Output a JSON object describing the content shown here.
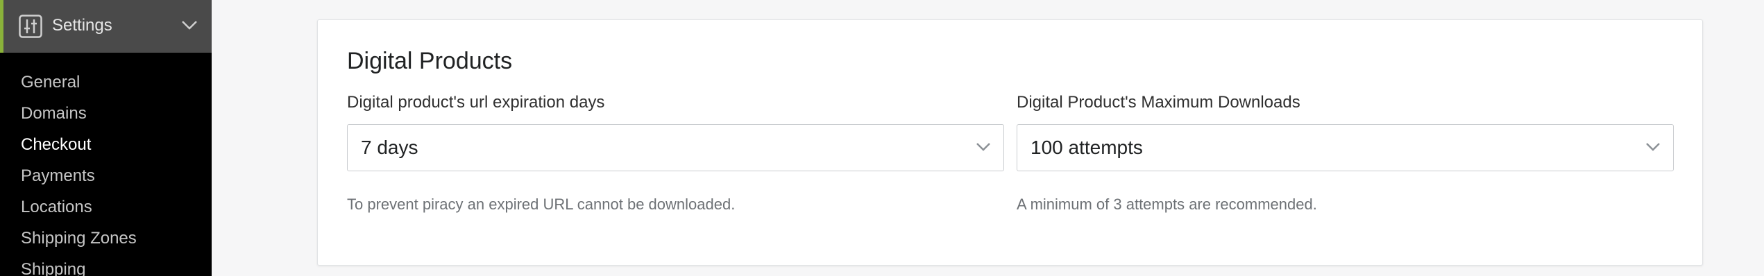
{
  "sidebar": {
    "header_label": "Settings",
    "items": [
      {
        "label": "General",
        "active": false
      },
      {
        "label": "Domains",
        "active": false
      },
      {
        "label": "Checkout",
        "active": true
      },
      {
        "label": "Payments",
        "active": false
      },
      {
        "label": "Locations",
        "active": false
      },
      {
        "label": "Shipping Zones",
        "active": false
      },
      {
        "label": "Shipping",
        "active": false
      }
    ]
  },
  "card": {
    "title": "Digital Products",
    "expiration": {
      "label": "Digital product's url expiration days",
      "value": "7 days",
      "help": "To prevent piracy an expired URL cannot be downloaded."
    },
    "downloads": {
      "label": "Digital Product's Maximum Downloads",
      "value": "100 attempts",
      "help": "A minimum of 3 attempts are recommended."
    }
  },
  "colors": {
    "accent": "#8ab23a",
    "sidebar_bg": "#000000",
    "header_bg": "#4a4a4a"
  },
  "icons": {
    "settings": "sliders-icon",
    "collapse": "chevron-down-icon"
  }
}
